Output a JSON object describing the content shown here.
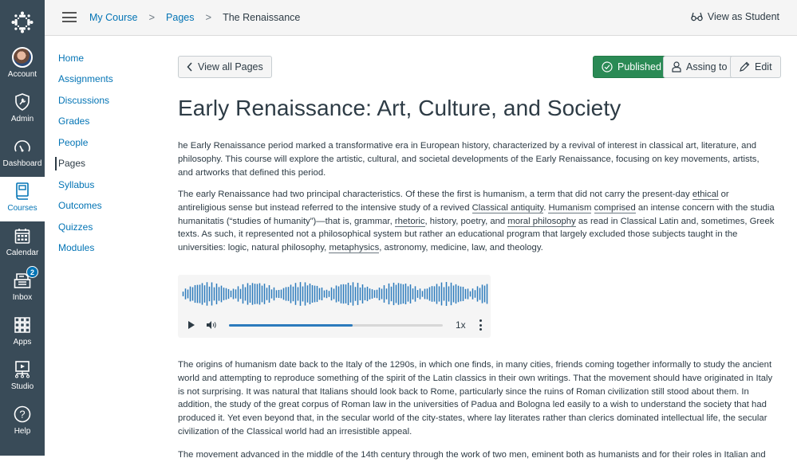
{
  "global_nav": {
    "items": [
      {
        "label": "Account",
        "icon": "avatar"
      },
      {
        "label": "Admin",
        "icon": "shield-icon"
      },
      {
        "label": "Dashboard",
        "icon": "speedometer-icon"
      },
      {
        "label": "Courses",
        "icon": "book-icon",
        "active": true
      },
      {
        "label": "Calendar",
        "icon": "calendar-icon"
      },
      {
        "label": "Inbox",
        "icon": "inbox-icon",
        "badge": "2"
      },
      {
        "label": "Apps",
        "icon": "apps-grid-icon"
      },
      {
        "label": "Studio",
        "icon": "studio-icon"
      },
      {
        "label": "Help",
        "icon": "help-icon"
      }
    ]
  },
  "topbar": {
    "breadcrumbs": [
      "My Course",
      "Pages",
      "The Renaissance"
    ],
    "view_as_student": "View as Student"
  },
  "course_nav": {
    "items": [
      "Home",
      "Assignments",
      "Discussions",
      "Grades",
      "People",
      "Pages",
      "Syllabus",
      "Outcomes",
      "Quizzes",
      "Modules"
    ],
    "active": "Pages"
  },
  "toolbar": {
    "view_all_pages": "View all Pages",
    "published": "Published",
    "assign_to": "Assing to",
    "edit": "Edit"
  },
  "page": {
    "title": "Early Renaissance: Art, Culture, and Society",
    "paragraphs": {
      "p1": "he Early Renaissance period marked a transformative era in European history, characterized by a revival of interest in classical art, literature, and philosophy. This course will explore the artistic, cultural, and societal developments of the Early Renaissance, focusing on key movements, artists, and artworks that defined this period.",
      "p2": {
        "a": "The early Renaissance had two principal characteristics. Of these the first is humanism, a term that did not carry the present-day ",
        "link1": "ethical",
        "b": " or antireligious sense but instead referred to the intensive study of a revived ",
        "link2": "Classical antiquity",
        "c": ". ",
        "link3": "Humanism",
        "d": " ",
        "link4": "comprised",
        "e": " an intense concern with the studia humanitatis (“studies of humanity”)—that is, grammar, ",
        "link5": "rhetoric",
        "f": ", history, poetry, and ",
        "link6": "moral philosophy",
        "g": " as read in Classical Latin and, sometimes, Greek texts. As such, it represented not a philosophical system but rather an educational program that largely excluded those subjects taught in the universities: logic, natural philosophy, ",
        "link7": "metaphysics",
        "h": ", astronomy, medicine, law, and theology."
      },
      "p3": "The origins of humanism date back to the Italy of the 1290s, in which one finds, in many cities, friends coming together informally to study the ancient world and attempting to reproduce something of the spirit of the Latin classics in their own writings. That the movement should have originated in Italy is not surprising. It was natural that Italians should look back to Rome, particularly since the ruins of Roman civilization still stood about them. In addition, the study of the great corpus of Roman law in the universities of Padua and Bologna led easily to a wish to understand the society that had produced it. Yet even beyond that, in the secular world of the city-states, where lay literates rather than clerics dominated intellectual life, the secular civilization of the Classical world had an irresistible appeal.",
      "p4": "The movement advanced in the middle of the 14th century through the work of two men, eminent both as humanists and for their roles in Italian and"
    }
  },
  "audio_player": {
    "progress": 0.58,
    "speed": "1x",
    "waveform_color": "#2b7abc"
  },
  "colors": {
    "nav_bg": "#394b58",
    "link": "#0374b5",
    "published": "#2a8a55",
    "text": "#2d3b45"
  }
}
